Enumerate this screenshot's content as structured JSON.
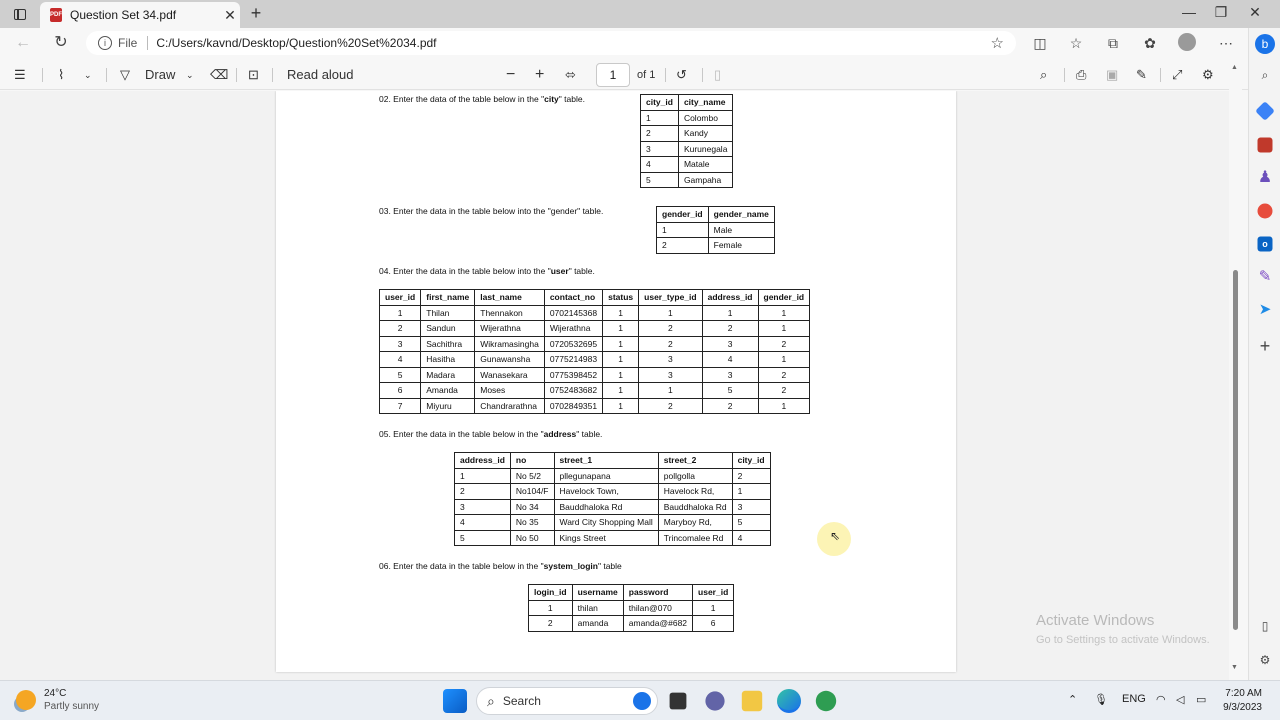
{
  "browser": {
    "tab_title": "Question Set 34.pdf",
    "url_scheme_label": "File",
    "url": "C:/Users/kavnd/Desktop/Question%20Set%2034.pdf"
  },
  "pdf_toolbar": {
    "draw_label": "Draw",
    "read_aloud_label": "Read aloud",
    "page_number": "1",
    "page_total": "of 1"
  },
  "document": {
    "q02": {
      "prefix": "02. Enter the data of the table below in the \"",
      "name": "city",
      "suffix": "\" table."
    },
    "q03": {
      "text": "03. Enter the data in the table below into the \"gender\" table."
    },
    "q04": {
      "prefix": "04. Enter the data in the table below into the \"",
      "name": "user",
      "suffix": "\" table."
    },
    "q05": {
      "prefix": "05. Enter the data in the table below in the \"",
      "name": "address",
      "suffix": "\" table."
    },
    "q06": {
      "prefix": "06. Enter the data in the table below in the \"",
      "name": "system_login",
      "suffix": "\" table"
    },
    "city_table": {
      "headers": [
        "city_id",
        "city_name"
      ],
      "rows": [
        [
          "1",
          "Colombo"
        ],
        [
          "2",
          "Kandy"
        ],
        [
          "3",
          "Kurunegala"
        ],
        [
          "4",
          "Matale"
        ],
        [
          "5",
          "Gampaha"
        ]
      ]
    },
    "gender_table": {
      "headers": [
        "gender_id",
        "gender_name"
      ],
      "rows": [
        [
          "1",
          "Male"
        ],
        [
          "2",
          "Female"
        ]
      ]
    },
    "user_table": {
      "headers": [
        "user_id",
        "first_name",
        "last_name",
        "contact_no",
        "status",
        "user_type_id",
        "address_id",
        "gender_id"
      ],
      "rows": [
        [
          "1",
          "Thilan",
          "Thennakon",
          "0702145368",
          "1",
          "1",
          "1",
          "1"
        ],
        [
          "2",
          "Sandun",
          "Wijerathna",
          "Wijerathna",
          "1",
          "2",
          "2",
          "1"
        ],
        [
          "3",
          "Sachithra",
          "Wikramasingha",
          "0720532695",
          "1",
          "2",
          "3",
          "2"
        ],
        [
          "4",
          "Hasitha",
          "Gunawansha",
          "0775214983",
          "1",
          "3",
          "4",
          "1"
        ],
        [
          "5",
          "Madara",
          "Wanasekara",
          "0775398452",
          "1",
          "3",
          "3",
          "2"
        ],
        [
          "6",
          "Amanda",
          "Moses",
          "0752483682",
          "1",
          "1",
          "5",
          "2"
        ],
        [
          "7",
          "Miyuru",
          "Chandrarathna",
          "0702849351",
          "1",
          "2",
          "2",
          "1"
        ]
      ]
    },
    "address_table": {
      "headers": [
        "address_id",
        "no",
        "street_1",
        "street_2",
        "city_id"
      ],
      "rows": [
        [
          "1",
          "No 5/2",
          "pllegunapana",
          "pollgolla",
          "2"
        ],
        [
          "2",
          "No104/F",
          "Havelock Town,",
          "Havelock Rd,",
          "1"
        ],
        [
          "3",
          "No 34",
          "Bauddhaloka Rd",
          "Bauddhaloka Rd",
          "3"
        ],
        [
          "4",
          "No 35",
          "Ward City Shopping Mall",
          "Maryboy Rd,",
          "5"
        ],
        [
          "5",
          "No 50",
          "Kings Street",
          "Trincomalee Rd",
          "4"
        ]
      ]
    },
    "login_table": {
      "headers": [
        "login_id",
        "username",
        "password",
        "user_id"
      ],
      "rows": [
        [
          "1",
          "thilan",
          "thilan@070",
          "1"
        ],
        [
          "2",
          "amanda",
          "amanda@#682",
          "6"
        ]
      ]
    }
  },
  "watermark": {
    "line1": "Activate Windows",
    "line2": "Go to Settings to activate Windows."
  },
  "taskbar": {
    "temperature": "24°C",
    "weather": "Partly sunny",
    "search_label": "Search",
    "language": "ENG",
    "time": "7:20 AM",
    "date": "9/3/2023"
  }
}
